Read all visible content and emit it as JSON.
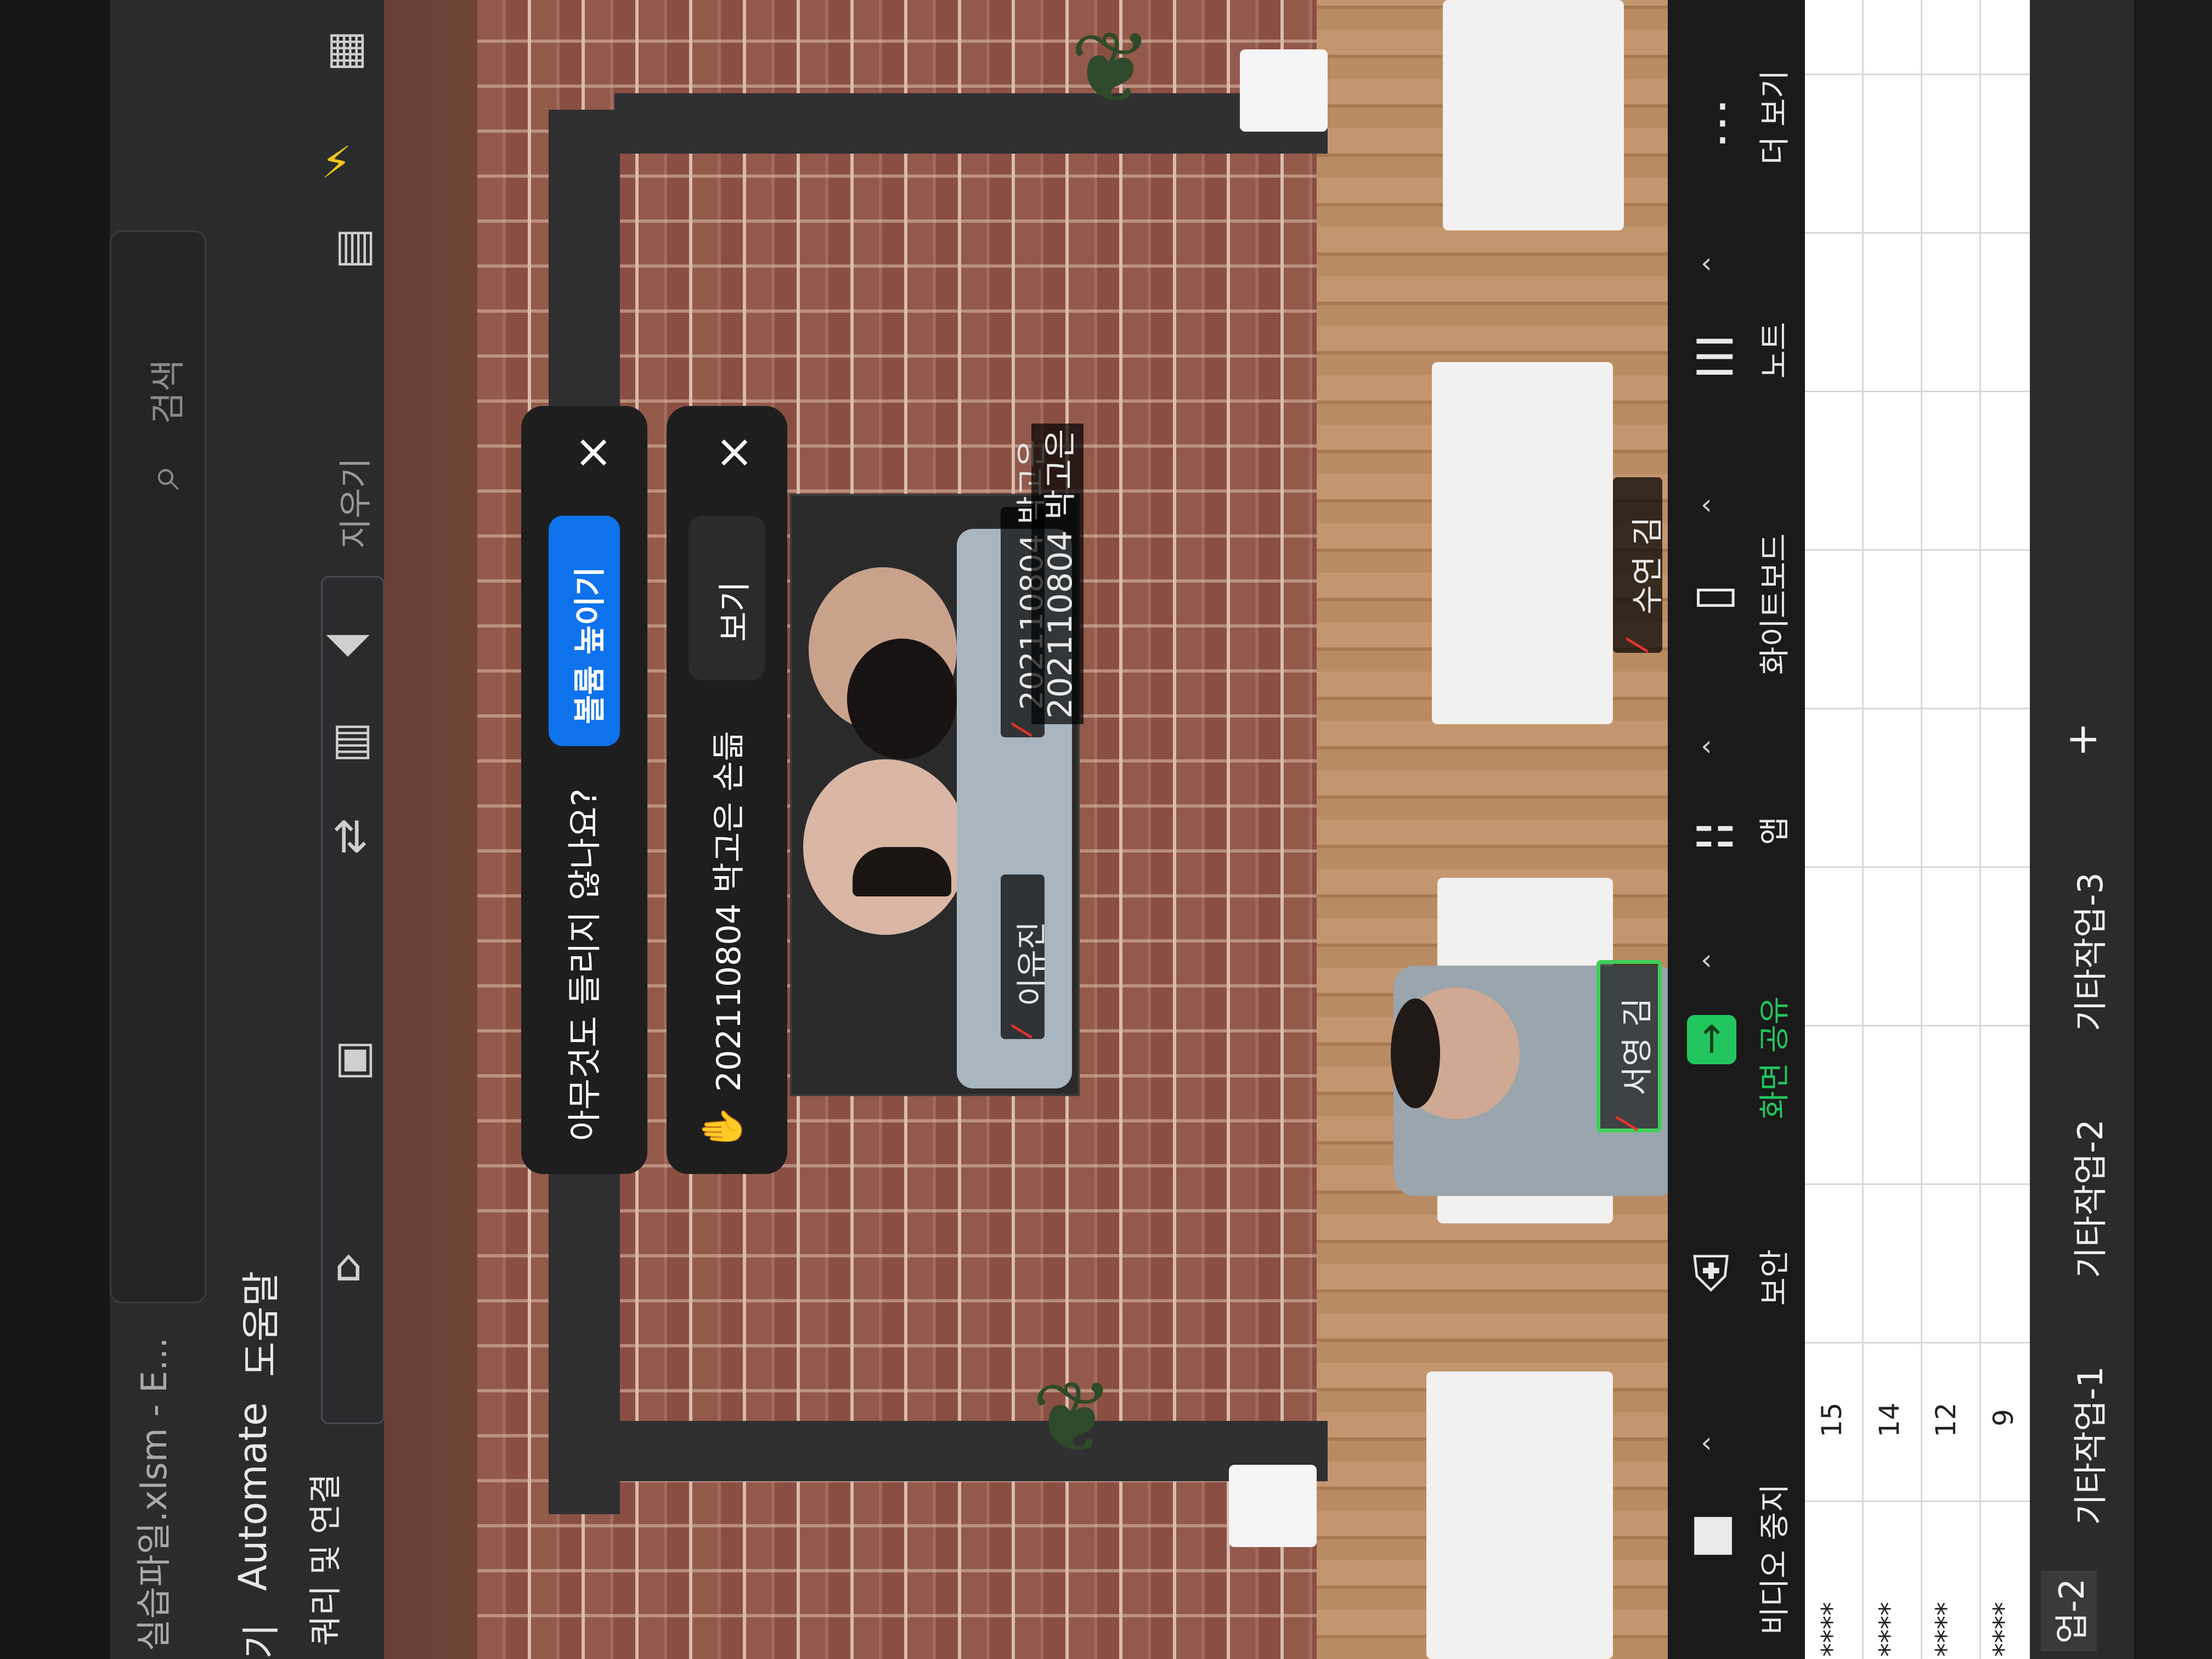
{
  "excel": {
    "file_title": "실습파일.xlsm - E...",
    "search_placeholder": "검색",
    "menu": {
      "automate": "Automate",
      "help": "도움말",
      "partial_tab": "기"
    },
    "ribbon": {
      "queries": "쿼리 및 연결",
      "clear": "지우기"
    },
    "rows": [
      {
        "stars": "****",
        "value": "15"
      },
      {
        "stars": "****",
        "value": "14"
      },
      {
        "stars": "****",
        "value": "12"
      },
      {
        "stars": "****",
        "value": "9"
      }
    ],
    "tabs": [
      "업-2",
      "기타작업-1",
      "기타작업-2",
      "기타작업-3"
    ],
    "add_sheet": "+"
  },
  "zoom": {
    "notice": {
      "text": "아무것도 들리지 않나요?",
      "button": "볼륨 높이기",
      "close": "×"
    },
    "hand_raise": {
      "emoji": "✋",
      "text": "202110804 박고은 손듦",
      "button": "보기",
      "close": "×"
    },
    "shared_tile": {
      "participants": [
        "이유진",
        "202110804 박고은"
      ],
      "top_label": "202110804 박고은"
    },
    "participants": [
      {
        "name": "서영 김",
        "active_speaker": true
      },
      {
        "name": "수연 김",
        "active_speaker": false
      }
    ],
    "toolbar": [
      {
        "label": "비디오 중지",
        "icon": "video-camera-icon"
      },
      {
        "label": "보안",
        "icon": "shield-icon"
      },
      {
        "label": "화면 공유",
        "icon": "share-screen-icon",
        "accent": "#22c55e"
      },
      {
        "label": "앱",
        "icon": "apps-icon"
      },
      {
        "label": "화이트보드",
        "icon": "whiteboard-icon"
      },
      {
        "label": "노트",
        "icon": "notes-icon"
      },
      {
        "label": "더 보기",
        "icon": "more-icon"
      }
    ],
    "colors": {
      "primary_button": "#0e72ed",
      "share_green": "#22c55e",
      "muted_red": "#e5312b"
    }
  }
}
